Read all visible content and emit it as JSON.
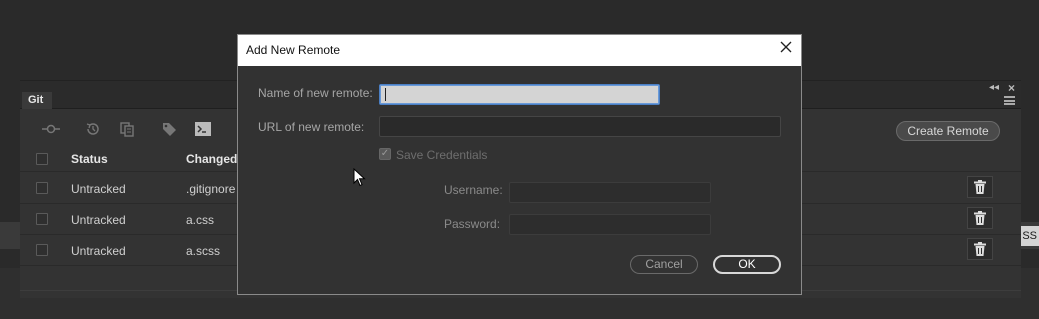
{
  "git_panel": {
    "tab_label": "Git",
    "create_remote_label": "Create Remote",
    "columns": {
      "status": "Status",
      "changed": "Changed F"
    },
    "rows": [
      {
        "status": "Untracked",
        "file": ".gitignore"
      },
      {
        "status": "Untracked",
        "file": "a.css"
      },
      {
        "status": "Untracked",
        "file": "a.scss"
      }
    ],
    "toolbar_icons": [
      "commit-icon",
      "history-icon",
      "diff-icon",
      "tag-icon",
      "terminal-icon"
    ]
  },
  "background": {
    "edge_text": "SS"
  },
  "dialog": {
    "title": "Add New Remote",
    "name_label": "Name of new remote:",
    "name_value": "",
    "url_label": "URL of new remote:",
    "url_value": "",
    "save_credentials_label": "Save Credentials",
    "save_credentials_checked": true,
    "username_label": "Username:",
    "username_value": "",
    "password_label": "Password:",
    "password_value": "",
    "cancel_label": "Cancel",
    "ok_label": "OK"
  },
  "colors": {
    "panel_bg": "#333333",
    "dialog_bg": "#323232",
    "focus_border": "#4b7fc4"
  }
}
